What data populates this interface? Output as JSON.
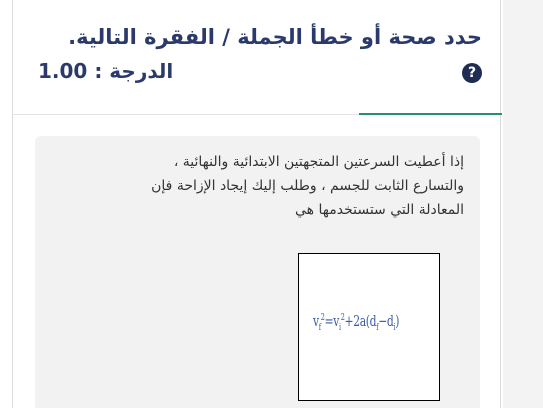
{
  "question": {
    "title": "حدد صحة أو خطأ الجملة / الفقرة التالية.",
    "grade": "الدرجة : 1.00",
    "help_icon": "question-circle-icon"
  },
  "content": {
    "lines": [
      "إذا أعطيت السرعتين المتجهتين الابتدائية والنهائية ،",
      "والتسارع الثابت للجسم ، وطلب إليك إيجاد الإزاحة فإن",
      "المعادلة التي ستستخدمها هي"
    ],
    "equation": {
      "lhs_base": "v",
      "lhs_sub": "f",
      "lhs_sup": "2",
      "rhs_base": "v",
      "rhs_sub": "i",
      "rhs_sup": "2",
      "rest_prefix": "+2a(d",
      "rest_sub1": "f",
      "rest_mid": "−d",
      "rest_sub2": "i",
      "rest_suffix": ")",
      "equals": "="
    }
  },
  "colors": {
    "title": "#2b3a6b",
    "accent": "#2a8c7a",
    "panel": "#f2f2f2",
    "equation_ink": "#3c5ca8"
  }
}
